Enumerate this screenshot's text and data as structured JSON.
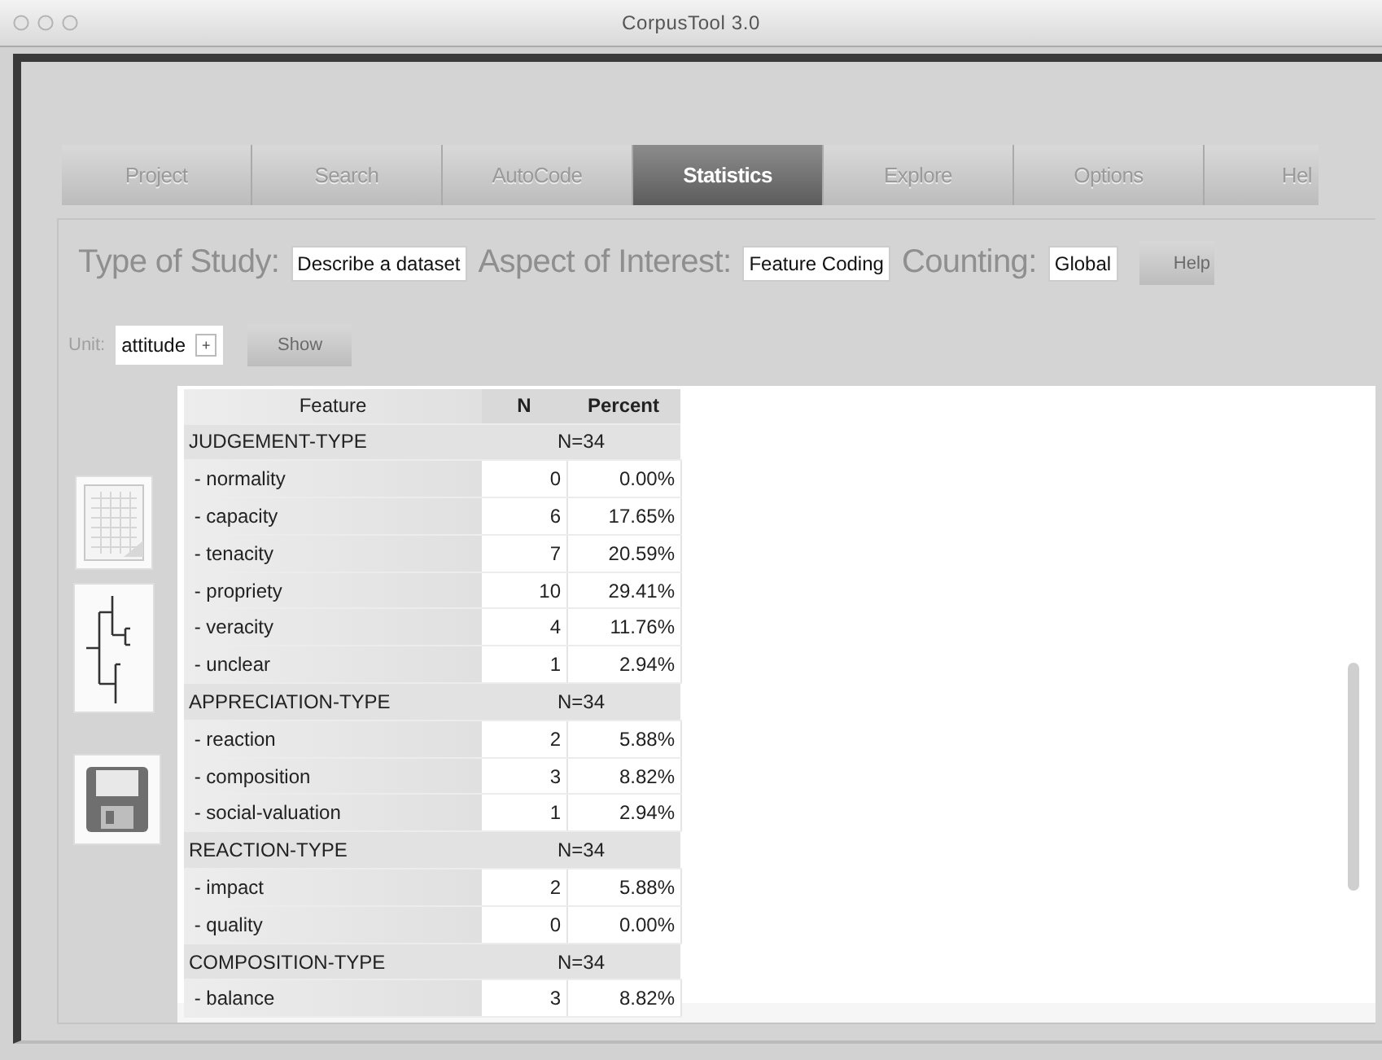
{
  "window": {
    "title": "CorpusTool 3.0"
  },
  "tabs": [
    {
      "label": "Project",
      "selected": false
    },
    {
      "label": "Search",
      "selected": false
    },
    {
      "label": "AutoCode",
      "selected": false
    },
    {
      "label": "Statistics",
      "selected": true
    },
    {
      "label": "Explore",
      "selected": false
    },
    {
      "label": "Options",
      "selected": false
    },
    {
      "label": "Hel",
      "selected": false
    }
  ],
  "study_bar": {
    "fields": [
      {
        "label": "Type of Study:",
        "value": "Describe a dataset"
      },
      {
        "label": "Aspect of Interest:",
        "value": "Feature Coding"
      },
      {
        "label": "Counting:",
        "value": "Global"
      }
    ],
    "help_button": "Help"
  },
  "unit_bar": {
    "label": "Unit:",
    "value": "attitude",
    "stepper": "+",
    "show_button": "Show"
  },
  "table": {
    "columns": [
      "Feature",
      "N",
      "Percent"
    ],
    "rows": [
      {
        "kind": "group",
        "label": "JUDGEMENT-TYPE",
        "total": "N=34"
      },
      {
        "kind": "item",
        "label": " - normality",
        "n": "0",
        "percent": "0.00%"
      },
      {
        "kind": "item",
        "label": " - capacity",
        "n": "6",
        "percent": "17.65%"
      },
      {
        "kind": "item",
        "label": " - tenacity",
        "n": "7",
        "percent": "20.59%"
      },
      {
        "kind": "item",
        "label": " - propriety",
        "n": "10",
        "percent": "29.41%"
      },
      {
        "kind": "item",
        "label": " - veracity",
        "n": "4",
        "percent": "11.76%"
      },
      {
        "kind": "item",
        "label": " - unclear",
        "n": "1",
        "percent": "2.94%"
      },
      {
        "kind": "group",
        "label": "APPRECIATION-TYPE",
        "total": "N=34"
      },
      {
        "kind": "item",
        "label": " - reaction",
        "n": "2",
        "percent": "5.88%"
      },
      {
        "kind": "item",
        "label": " - composition",
        "n": "3",
        "percent": "8.82%"
      },
      {
        "kind": "item",
        "label": " - social-valuation",
        "n": "1",
        "percent": "2.94%"
      },
      {
        "kind": "group",
        "label": "REACTION-TYPE",
        "total": "N=34"
      },
      {
        "kind": "item",
        "label": " - impact",
        "n": "2",
        "percent": "5.88%"
      },
      {
        "kind": "item",
        "label": " - quality",
        "n": "0",
        "percent": "0.00%"
      },
      {
        "kind": "group",
        "label": "COMPOSITION-TYPE",
        "total": "N=34"
      },
      {
        "kind": "item",
        "label": " - balance",
        "n": "3",
        "percent": "8.82%"
      }
    ]
  }
}
